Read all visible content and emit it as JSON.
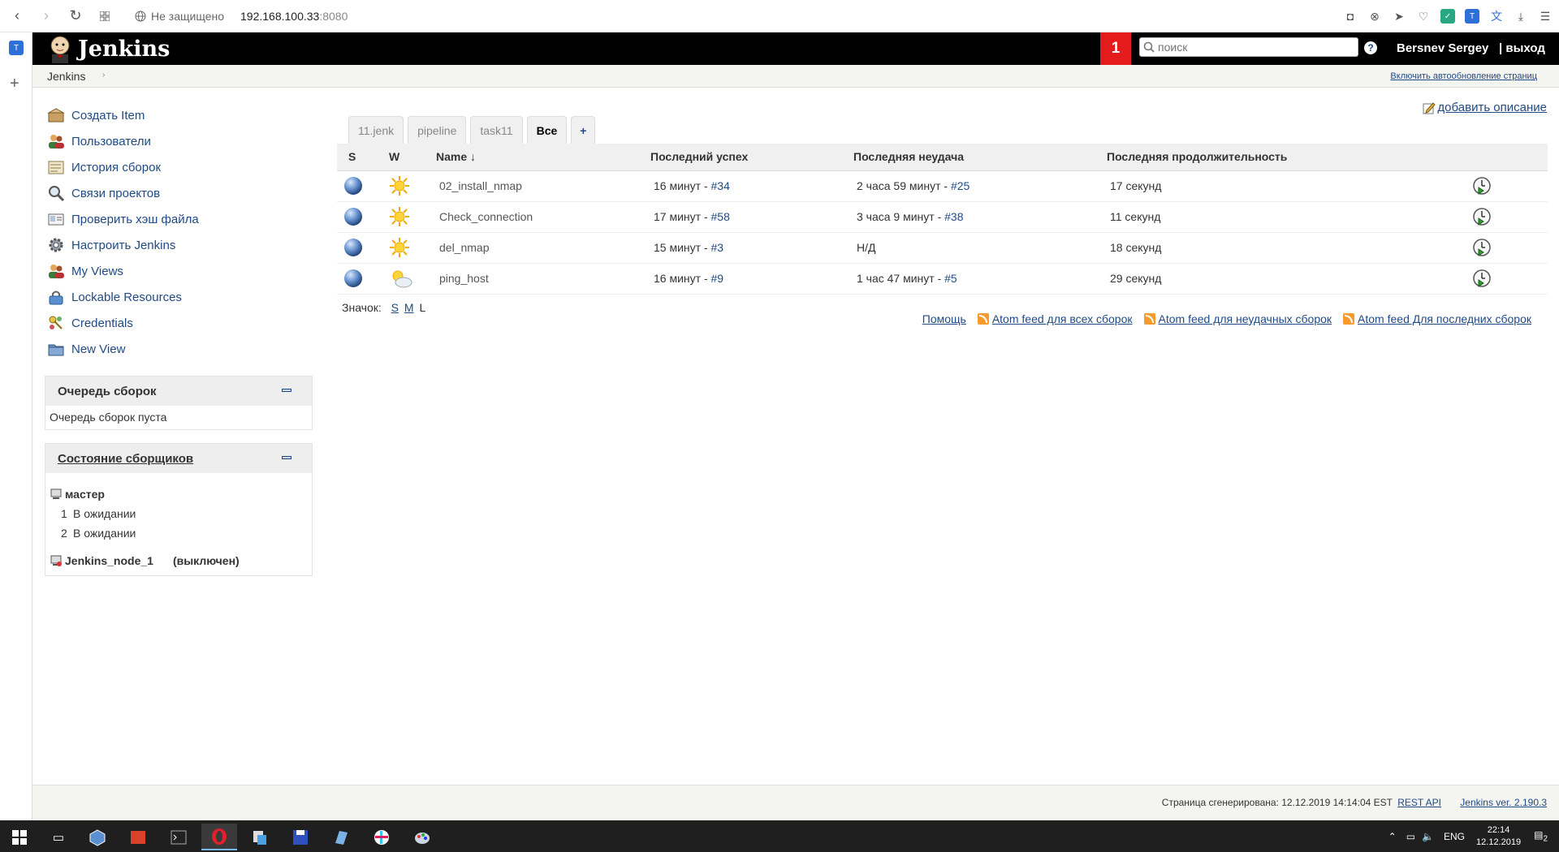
{
  "browser": {
    "security_label": "Не защищено",
    "host": "192.168.100.33",
    "port": ":8080"
  },
  "header": {
    "title": "Jenkins",
    "notification_count": "1",
    "search_placeholder": "поиск",
    "help": "?",
    "user": "Bersnev Sergey",
    "logout": "| выход"
  },
  "breadcrumb": {
    "root": "Jenkins",
    "auto_refresh": "Включить автообновление страниц"
  },
  "tasks": [
    {
      "label": "Создать Item",
      "icon": "new-package-icon"
    },
    {
      "label": "Пользователи",
      "icon": "users-icon"
    },
    {
      "label": "История сборок",
      "icon": "notepad-icon"
    },
    {
      "label": "Связи проектов",
      "icon": "search-icon"
    },
    {
      "label": "Проверить хэш файла",
      "icon": "fingerprint-icon"
    },
    {
      "label": "Настроить Jenkins",
      "icon": "gear-icon"
    },
    {
      "label": "My Views",
      "icon": "users-icon"
    },
    {
      "label": "Lockable Resources",
      "icon": "lock-icon"
    },
    {
      "label": "Credentials",
      "icon": "keys-icon"
    },
    {
      "label": "New View",
      "icon": "folder-icon"
    }
  ],
  "queue": {
    "title": "Очередь сборок",
    "empty_text": "Очередь сборок пуста"
  },
  "executors": {
    "title": "Состояние сборщиков",
    "master": {
      "name": "мастер",
      "slots": [
        {
          "n": "1",
          "state": "В ожидании"
        },
        {
          "n": "2",
          "state": "В ожидании"
        }
      ]
    },
    "node": {
      "name": "Jenkins_node_1",
      "status": "(выключен)"
    }
  },
  "main": {
    "add_description": "добавить описание",
    "tabs": [
      "11.jenk",
      "pipeline",
      "task11",
      "Все",
      "+"
    ],
    "active_tab": "Все",
    "columns": {
      "s": "S",
      "w": "W",
      "name": "Name",
      "sort": "↓",
      "last_success": "Последний успех",
      "last_failure": "Последняя неудача",
      "last_duration": "Последняя продолжительность"
    },
    "jobs": [
      {
        "name": "02_install_nmap",
        "weather": "sunny",
        "success_time": "16 минут - ",
        "success_build": "#34",
        "failure_time": "2 часа 59 минут - ",
        "failure_build": "#25",
        "duration": "17 секунд"
      },
      {
        "name": "Check_connection",
        "weather": "sunny",
        "success_time": "17 минут - ",
        "success_build": "#58",
        "failure_time": "3 часа 9 минут - ",
        "failure_build": "#38",
        "duration": "11 секунд"
      },
      {
        "name": "del_nmap",
        "weather": "sunny",
        "success_time": "15 минут - ",
        "success_build": "#3",
        "failure_time": "Н/Д",
        "failure_build": "",
        "duration": "18 секунд"
      },
      {
        "name": "ping_host",
        "weather": "partly-cloudy",
        "success_time": "16 минут - ",
        "success_build": "#9",
        "failure_time": "1 час 47 минут - ",
        "failure_build": "#5",
        "duration": "29 секунд"
      }
    ],
    "icon_size_label": "Значок:",
    "icon_sizes": [
      "S",
      "M",
      "L"
    ],
    "help_link": "Помощь",
    "feeds": [
      "Atom feed для всех сборок",
      "Atom feed для неудачных сборок",
      "Atom feed Для последних сборок"
    ]
  },
  "footer": {
    "generated": "Страница сгенерирована: 12.12.2019 14:14:04 EST",
    "rest_api": "REST API",
    "version": "Jenkins ver. 2.190.3"
  },
  "taskbar": {
    "lang": "ENG",
    "time": "22:14",
    "date": "12.12.2019",
    "notif_count": "2"
  },
  "colors": {
    "header_bg": "#000000",
    "badge": "#e31b1b",
    "link": "#204a87",
    "status_ball": "#4a7bc4"
  }
}
